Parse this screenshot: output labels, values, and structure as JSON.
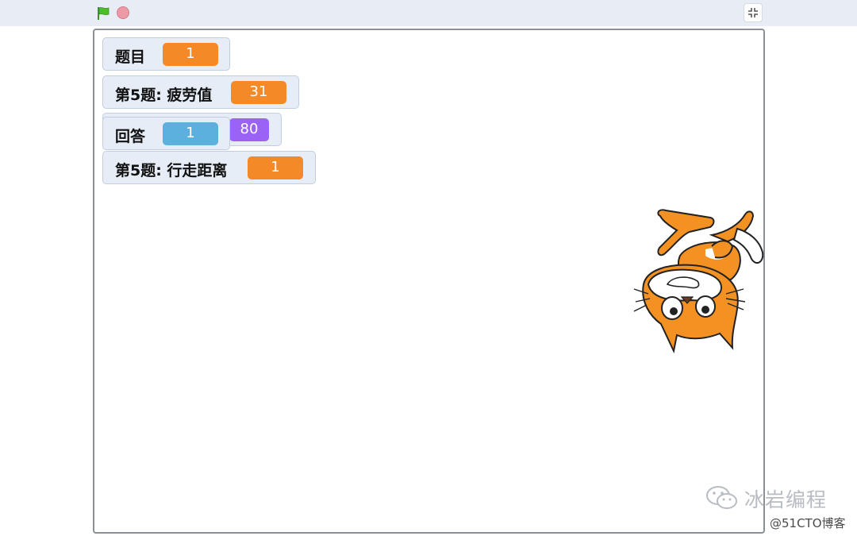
{
  "toolbar": {
    "green_flag_icon": "green-flag-icon",
    "stop_icon": "stop-icon",
    "fullscreen_icon": "exit-fullscreen-icon"
  },
  "monitors": [
    {
      "label": "题目",
      "value": "1",
      "color": "#f38a27"
    },
    {
      "label": "第5题: 疲劳值",
      "value": "31",
      "color": "#f38a27"
    },
    {
      "label": "",
      "value": "80",
      "color": "#9b63f5"
    },
    {
      "label": "回答",
      "value": "1",
      "color": "#5bb0dd"
    },
    {
      "label": "第5题: 行走距离",
      "value": "1",
      "color": "#f38a27"
    }
  ],
  "sprite": {
    "name": "scratch-cat-sprite"
  },
  "watermark": {
    "main": "冰岩编程",
    "sub": "@51CTO博客"
  }
}
